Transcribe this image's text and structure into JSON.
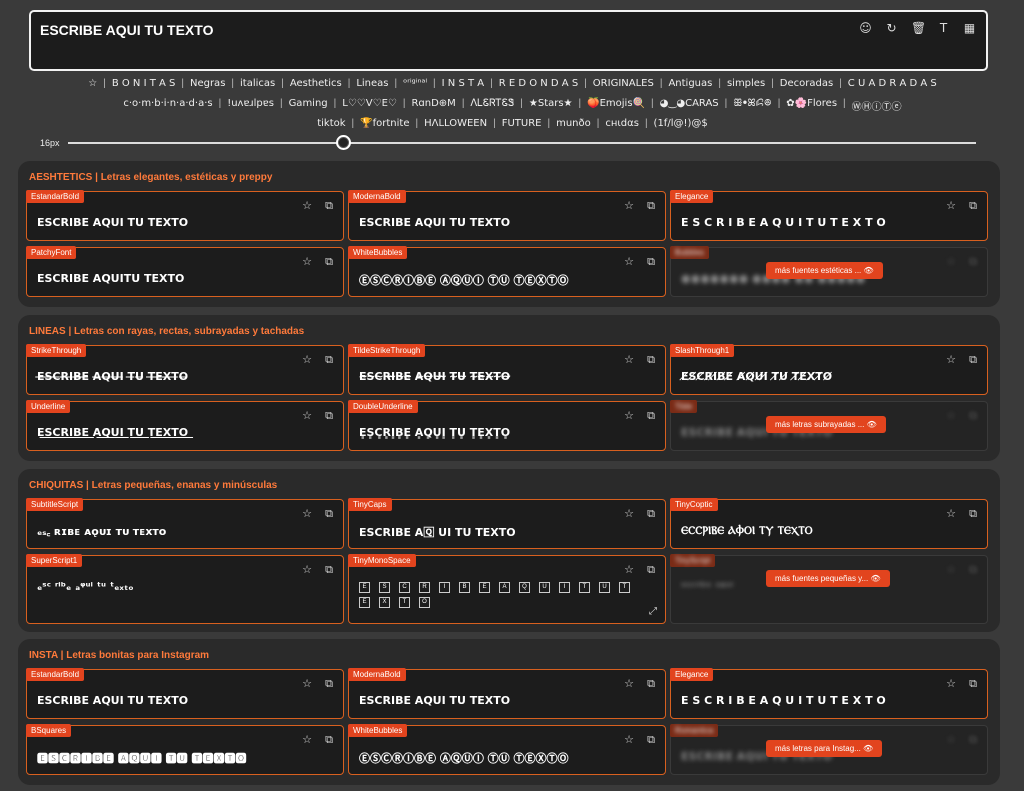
{
  "editor": {
    "text": "ESCRIBE AQUI TU TEXTO",
    "tools": [
      "smiley-icon",
      "refresh-icon",
      "trash-icon",
      "font-icon",
      "grid-icon"
    ]
  },
  "categories": {
    "row1": [
      "☆",
      "B O N I T A S",
      "Negras",
      "italicas",
      "Aesthetics",
      "Lineas",
      "ᵒʳⁱᵍⁱⁿᵃˡ",
      "I N S T A",
      "R E D O N D A S",
      "ORIGINALES",
      "Antiguas",
      "simples",
      "Decoradas",
      "C U A D R A D A S"
    ],
    "row2": [
      "c·o·m·b·i·n·a·d·a·s",
      "!uʌɐɹlpɐs",
      "Gaming",
      "L♡♡V♡E♡",
      "RɑnD⊕M",
      "ᐱᏞᏋᏒᎢᏋᏕ",
      "★Stars★",
      "🍑Emojis🍭",
      "◕‿◕CARAS",
      "ꕥꔷꕤꗲꔮ",
      "✿🌸Flores",
      "ⓌⒽⓘⓉⓔ"
    ],
    "row3": [
      "tiktok",
      "🏆fortnite",
      "HΛLLOWEEN",
      "FUTURE",
      "munðo",
      "cнιdαѕ",
      "(1f/l@!)@$"
    ]
  },
  "slider": {
    "label": "16px",
    "value_fraction": 0.3
  },
  "sections": [
    {
      "title": "AESHTETICS | Letras elegantes, estéticas y preppy",
      "cards": [
        {
          "tag": "EstandarBold",
          "text": "ESCRIBE AQUI TU TEXTO"
        },
        {
          "tag": "ModernaBold",
          "text": "ESCRIBE AQUI TU TEXTO"
        },
        {
          "tag": "Elegance",
          "text": "E S C R I B E  A Q U I  T U  T E X T O"
        },
        {
          "tag": "PatchyFont",
          "text": "ESCRIBE AQUITU TEXTO"
        },
        {
          "tag": "WhiteBubbles",
          "text": "ⒺⓈⒸⓇⒾⒷⒺ ⒶⓆⓊⒾ ⓉⓊ ⓉⒺⓍⓉⓄ"
        },
        {
          "tag": "Bubbles",
          "text": "●●●●●●● ●●●● ●● ●●●●●",
          "more": "más fuentes estéticas ..."
        }
      ]
    },
    {
      "title": "LINEAS | Letras con rayas, rectas, subrayadas y tachadas",
      "cards": [
        {
          "tag": "StrikeThrough",
          "text": "E̶S̶C̶R̶I̶B̶E̶ A̶Q̶U̶I̶ T̶U̶ T̶E̶X̶T̶O̶"
        },
        {
          "tag": "TildeStrikeThrough",
          "text": "E̴S̴C̴R̴I̴B̴E̴ A̴Q̴U̴I̴ T̴U̴ T̴E̴X̴T̴O̴"
        },
        {
          "tag": "SlashThrough1",
          "text": "E̸S̸C̸R̸I̸B̸E̸ A̸Q̸U̸I̸ T̸U̸ T̸E̸X̸T̸O̸"
        },
        {
          "tag": "Underline",
          "text": "E͟S͟C͟R͟I͟B͟E͟ A͟Q͟U͟I͟ T͟U͟ T͟E͟X͟T͟O͟"
        },
        {
          "tag": "DoubleUnderline",
          "text": "E͇S͇C͇R͇I͇B͇E͇ A͇Q͇U͇I͇ T͇U͇ T͇E͇X͇T͇O͇"
        },
        {
          "tag": "Tilde",
          "text": "ESCRIBE AQUI TU TEXTO",
          "more": "más letras subrayadas ..."
        }
      ]
    },
    {
      "title": "CHIQUITAS | Letras pequeñas, enanas y minúsculas",
      "cards": [
        {
          "tag": "SubtitleScript",
          "text": "ₑₛ꜀ ʀɪʙᴇ ᴀǫᴜɪ ᴛᴜ ᴛᴇxᴛᴏ"
        },
        {
          "tag": "TinyCaps",
          "text": "ESCRIBE A🅀 UI TU TEXTO"
        },
        {
          "tag": "TinyCoptic",
          "text": "ⲈⲤⲤⲢⲒⲂⲈ ⲀⲪⲞⲒ ⲦⲨ ⲦⲈⲬⲦⲞ"
        },
        {
          "tag": "SuperScript1",
          "text": "ₑˢᶜ ʳⁱᵇₑ ₐᵠᵘⁱ ᵗᵘ ᵗₑₓₜₒ"
        },
        {
          "tag": "TinyMonoSpace",
          "letters": [
            "E",
            "S",
            "C",
            "R",
            "I",
            "B",
            "E",
            "A",
            "Q",
            "U",
            "I",
            "T",
            "U",
            "T",
            "E",
            "X",
            "T",
            "O"
          ]
        },
        {
          "tag": "TinyScript",
          "text": "ᵉˢᶜʳⁱᵇᵉ ᵃᵠᵘⁱ",
          "more": "más fuentes pequeñas y..."
        }
      ]
    },
    {
      "title": "INSTA | Letras bonitas para Instagram",
      "cards": [
        {
          "tag": "EstandarBold",
          "text": "ESCRIBE AQUI TU TEXTO"
        },
        {
          "tag": "ModernaBold",
          "text": "ESCRIBE AQUI TU TEXTO"
        },
        {
          "tag": "Elegance",
          "text": "E S C R I B E  A Q U I  T U  T E X T O"
        },
        {
          "tag": "BSquares",
          "text": "🅴🆂🅲🆁🅸🅱🅴 🅰🆀🆄🅸 🆃🆄 🆃🅴🆇🆃🅾"
        },
        {
          "tag": "WhiteBubbles",
          "text": "ⒺⓈⒸⓇⒾⒷⒺ ⒶⓆⓊⒾ ⓉⓊ ⓉⒺⓍⓉⓄ"
        },
        {
          "tag": "Romantica",
          "text": "ESCRIBE AQUI TU TEXTO",
          "more": "más letras para Instag..."
        }
      ]
    }
  ]
}
